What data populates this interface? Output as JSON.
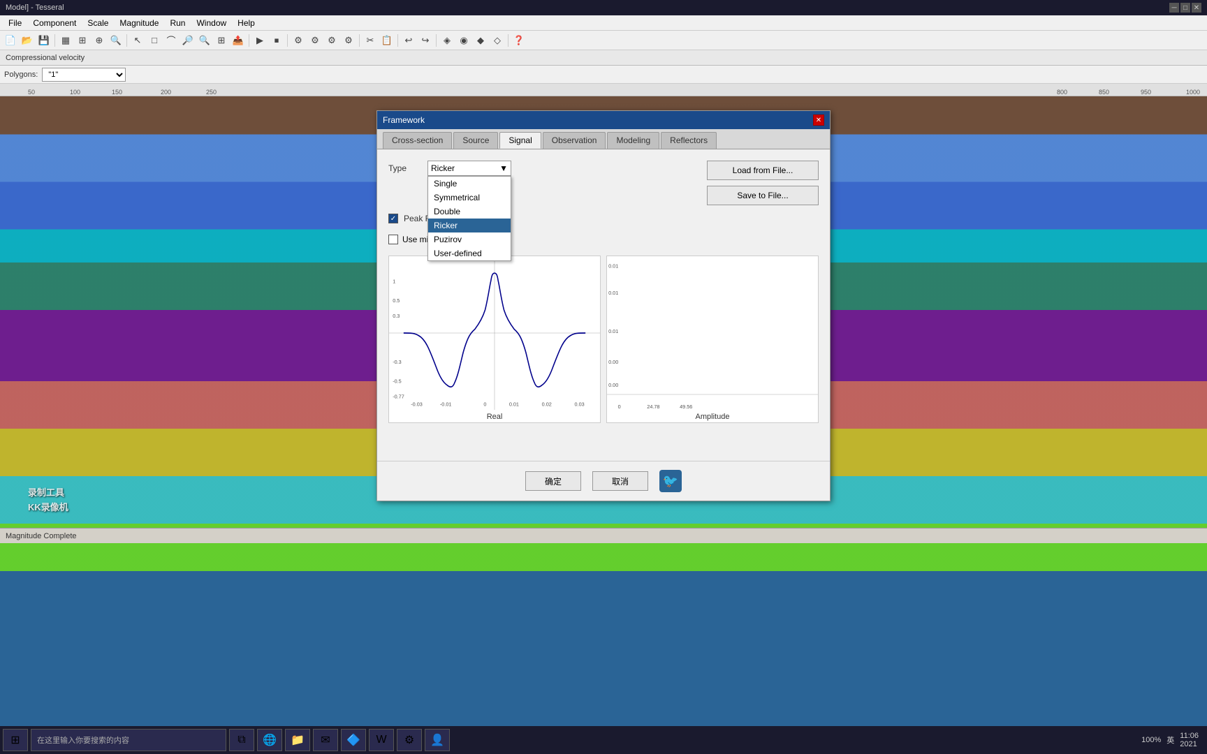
{
  "window": {
    "title": "Model] - Tesseral",
    "close_btn": "—"
  },
  "menubar": {
    "items": [
      "File",
      "Component",
      "Scale",
      "Magnitude",
      "Run",
      "Window",
      "Help"
    ]
  },
  "canvas_header": {
    "label": "Compressional velocity"
  },
  "polygon_bar": {
    "label": "Polygons:",
    "value": "\"1\""
  },
  "ruler": {
    "ticks": [
      "50",
      "100",
      "150",
      "200",
      "250"
    ]
  },
  "dialog": {
    "title": "Framework",
    "tabs": [
      "Cross-section",
      "Source",
      "Signal",
      "Observation",
      "Modeling",
      "Reflectors"
    ],
    "active_tab": "Signal",
    "type_label": "Type",
    "dropdown": {
      "value": "Ricker",
      "options": [
        "Single",
        "Symmetrical",
        "Double",
        "Ricker",
        "Puzirov",
        "User-defined"
      ],
      "selected": "Ricker"
    },
    "load_btn": "Load from File...",
    "save_btn": "Save to File...",
    "peak_freq": {
      "checkbox_checked": true,
      "label": "Peak Fre",
      "value": "",
      "unit": "Hz"
    },
    "minimal_phase": {
      "checkbox_checked": false,
      "label": "Use minimal-phase signal"
    },
    "chart_real_label": "Real",
    "chart_amplitude_label": "Amplitude",
    "footer": {
      "ok": "确定",
      "cancel": "取消"
    }
  },
  "status_bar": {
    "text": "Magnitude Complete"
  },
  "watermark": {
    "line1": "录制工具",
    "line2": "KK录像机"
  },
  "taskbar": {
    "time": "11:06",
    "date": "2021",
    "percent": "100%",
    "lang": "英"
  }
}
